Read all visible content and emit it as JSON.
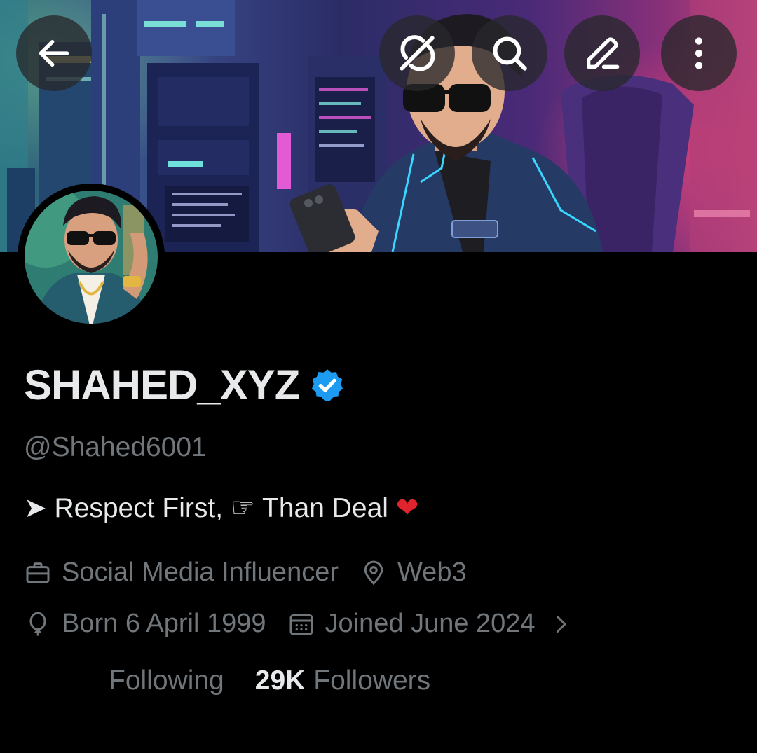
{
  "header": {
    "back_icon": "arrow-left-icon",
    "grok_icon": "grok-icon",
    "search_icon": "search-icon",
    "edit_icon": "edit-icon",
    "more_icon": "more-vertical-icon"
  },
  "profile": {
    "display_name": "SHAHED_XYZ",
    "verified_icon": "verified-badge-icon",
    "verified_color": "#1d9bf0",
    "handle": "@Shahed6001",
    "bio": "➤ Respect First, ☞ Than Deal",
    "bio_emoji": "❤",
    "category": "Social Media Influencer",
    "location": "Web3",
    "birth": "Born 6 April 1999",
    "joined": "Joined June 2024",
    "following_label": "Following",
    "followers_count": "29K",
    "followers_label": "Followers"
  },
  "colors": {
    "background": "#000000",
    "primary_text": "#e7e9ea",
    "secondary_text": "#71767b"
  }
}
